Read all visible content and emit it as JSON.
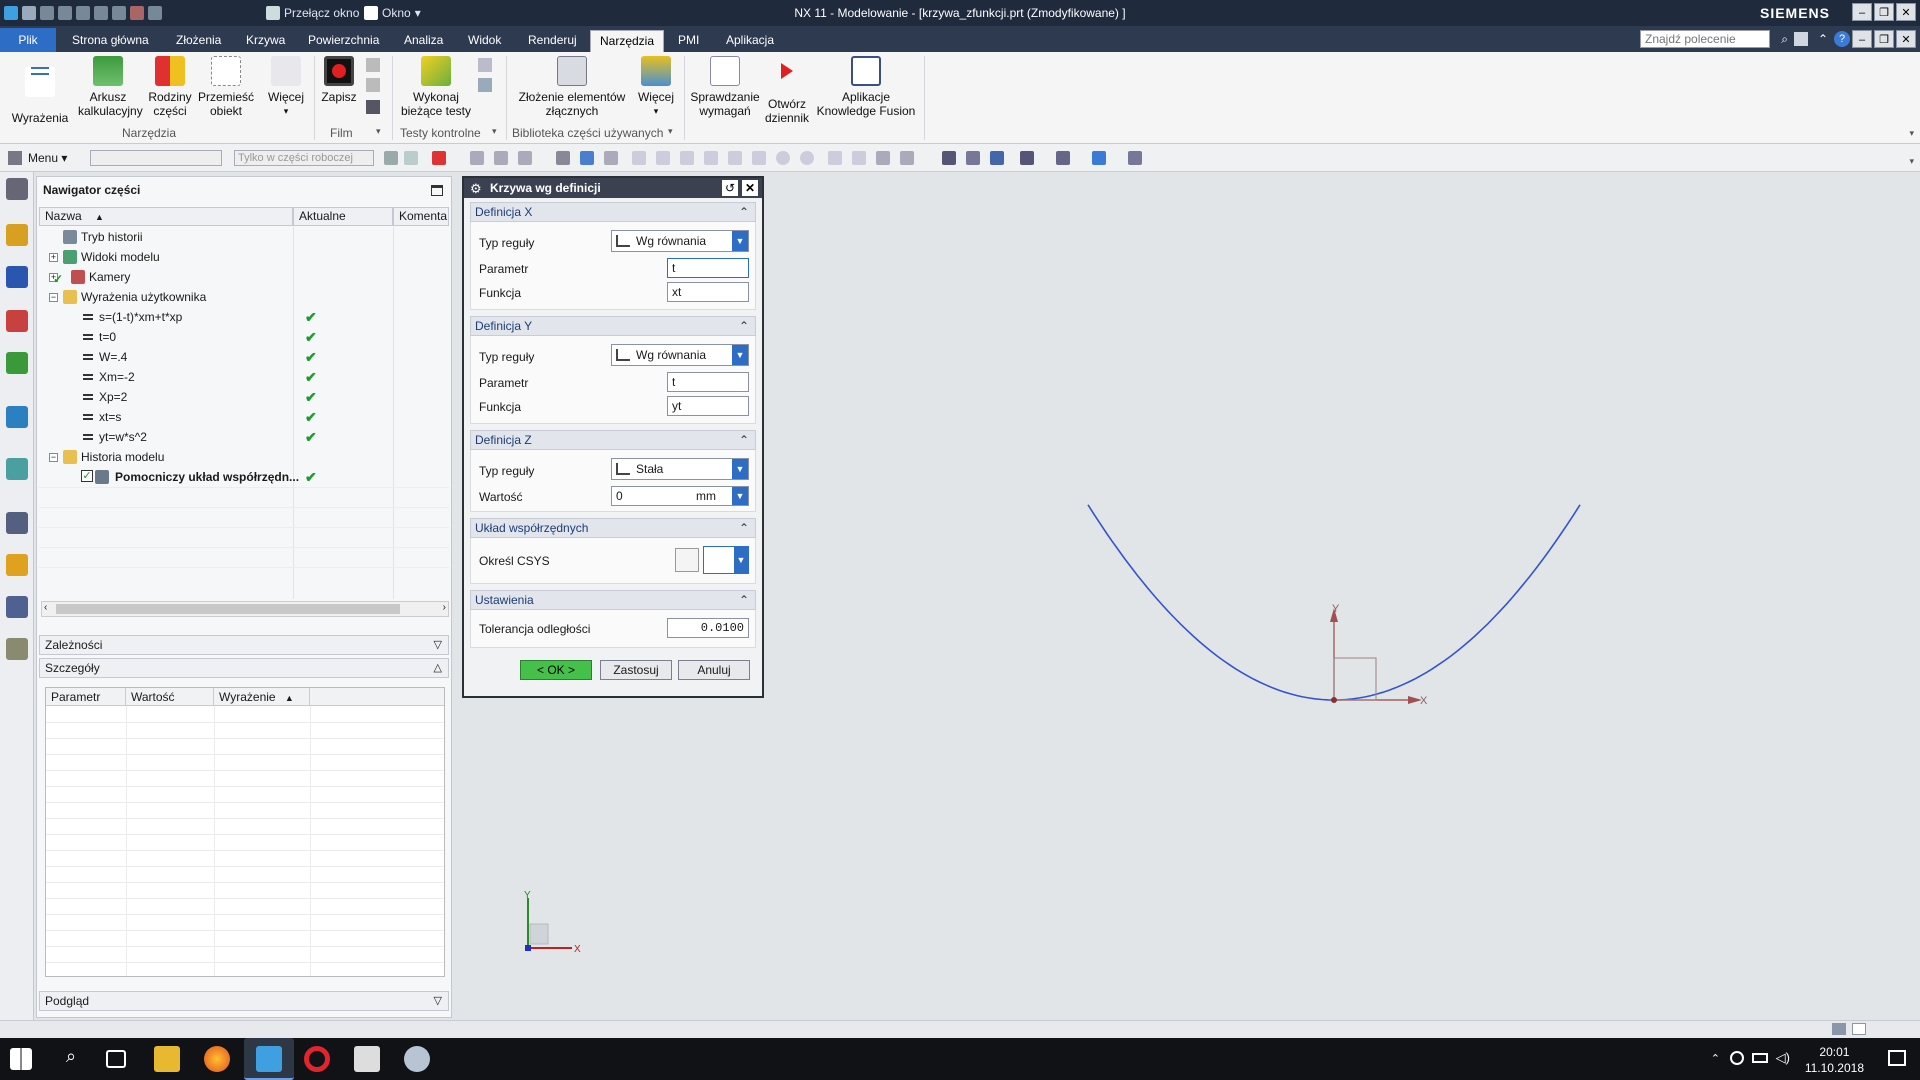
{
  "window": {
    "title": "NX 11 - Modelowanie - [krzywa_zfunkcji.prt (Zmodyfikowane) ]",
    "brand": "SIEMENS",
    "switch_window": "Przełącz okno",
    "window_menu": "Okno"
  },
  "menu_tabs": [
    "Plik",
    "Strona główna",
    "Złożenia",
    "Krzywa",
    "Powierzchnia",
    "Analiza",
    "Widok",
    "Renderuj",
    "Narzędzia",
    "PMI",
    "Aplikacja"
  ],
  "active_tab": "Narzędzia",
  "command_find_placeholder": "Znajdź polecenie",
  "ribbon": {
    "buttons": [
      "Wyrażenia",
      "Arkusz kalkulacyjny",
      "Rodziny części",
      "Przemieść obiekt",
      "Więcej",
      "Zapisz",
      "Wykonaj bieżące testy",
      "Złożenie elementów złącznych",
      "Więcej",
      "Sprawdzanie wymagań",
      "Otwórz dziennik",
      "Aplikacje Knowledge Fusion"
    ],
    "groups": [
      "Narzędzia",
      "Film",
      "Testy kontrolne",
      "Biblioteka części używanych"
    ]
  },
  "toolbar": {
    "menu_label": "Menu",
    "filter_placeholder": "Tylko w części roboczej"
  },
  "navigator": {
    "title": "Nawigator części",
    "columns": [
      "Nazwa",
      "Aktualne",
      "Komenta"
    ],
    "items": [
      {
        "label": "Tryb historii",
        "level": 0,
        "check": false,
        "bold": false
      },
      {
        "label": "Widoki modelu",
        "level": 0,
        "check": false,
        "bold": false
      },
      {
        "label": "Kamery",
        "level": 0,
        "check": false,
        "bold": false
      },
      {
        "label": "Wyrażenia użytkownika",
        "level": 0,
        "check": false,
        "bold": false
      },
      {
        "label": "s=(1-t)*xm+t*xp",
        "level": 1,
        "check": true,
        "bold": false
      },
      {
        "label": "t=0",
        "level": 1,
        "check": true,
        "bold": false
      },
      {
        "label": "W=.4",
        "level": 1,
        "check": true,
        "bold": false
      },
      {
        "label": "Xm=-2",
        "level": 1,
        "check": true,
        "bold": false
      },
      {
        "label": "Xp=2",
        "level": 1,
        "check": true,
        "bold": false
      },
      {
        "label": "xt=s",
        "level": 1,
        "check": true,
        "bold": false
      },
      {
        "label": "yt=w*s^2",
        "level": 1,
        "check": true,
        "bold": false
      },
      {
        "label": "Historia modelu",
        "level": 0,
        "check": false,
        "bold": false
      },
      {
        "label": "Pomocniczy układ współrzędn...",
        "level": 1,
        "check": true,
        "bold": true
      }
    ],
    "dependencies": "Zależności",
    "details": "Szczegóły",
    "details_columns": [
      "Parametr",
      "Wartość",
      "Wyrażenie"
    ],
    "preview": "Podgląd"
  },
  "dialog": {
    "title": "Krzywa wg definicji",
    "sections": {
      "x": {
        "title": "Definicja X",
        "rule_label": "Typ reguły",
        "rule": "Wg równania",
        "param_label": "Parametr",
        "param": "t",
        "func_label": "Funkcja",
        "func": "xt"
      },
      "y": {
        "title": "Definicja Y",
        "rule_label": "Typ reguły",
        "rule": "Wg równania",
        "param_label": "Parametr",
        "param": "t",
        "func_label": "Funkcja",
        "func": "yt"
      },
      "z": {
        "title": "Definicja Z",
        "rule_label": "Typ reguły",
        "rule": "Stała",
        "value_label": "Wartość",
        "value": "0",
        "unit": "mm"
      },
      "csys": {
        "title": "Układ współrzędnych",
        "label": "Określ CSYS"
      },
      "settings": {
        "title": "Ustawienia",
        "tol_label": "Tolerancja odległości",
        "tol": "0.0100"
      }
    },
    "ok": "< OK >",
    "apply": "Zastosuj",
    "cancel": "Anuluj"
  },
  "viewport": {
    "axis_x": "X",
    "axis_y": "Y",
    "triad_x": "X",
    "triad_y": "Y",
    "curve_color": "#3355cc"
  },
  "clock": {
    "time": "20:01",
    "date": "11.10.2018"
  }
}
